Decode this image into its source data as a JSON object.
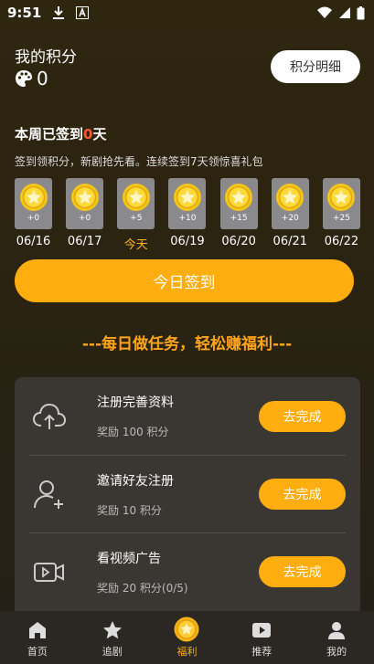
{
  "status_bar": {
    "time": "9:51"
  },
  "points": {
    "label": "我的积分",
    "value": "0",
    "detail_button": "积分明细"
  },
  "checkin": {
    "title_prefix": "本周已签到",
    "days_count": "0",
    "title_suffix": "天",
    "subtitle": "签到领积分，新剧抢先看。连续签到7天领惊喜礼包",
    "days": [
      {
        "reward": "+0",
        "date": "06/16",
        "today": false
      },
      {
        "reward": "+0",
        "date": "06/17",
        "today": false
      },
      {
        "reward": "+5",
        "date": "今天",
        "today": true
      },
      {
        "reward": "+10",
        "date": "06/19",
        "today": false
      },
      {
        "reward": "+15",
        "date": "06/20",
        "today": false
      },
      {
        "reward": "+20",
        "date": "06/21",
        "today": false
      },
      {
        "reward": "+25",
        "date": "06/22",
        "today": false
      }
    ],
    "button_label": "今日签到"
  },
  "slogan": "---每日做任务，轻松赚福利---",
  "tasks": [
    {
      "icon": "cloud-upload-icon",
      "title": "注册完善资料",
      "reward": "奖励 100 积分",
      "button": "去完成"
    },
    {
      "icon": "add-user-icon",
      "title": "邀请好友注册",
      "reward": "奖励 10 积分",
      "button": "去完成"
    },
    {
      "icon": "video-icon",
      "title": "看视频广告",
      "reward": "奖励 20 积分(0/5)",
      "button": "去完成"
    }
  ],
  "bottom_nav": [
    {
      "label": "首页",
      "icon": "home-icon",
      "active": false
    },
    {
      "label": "追剧",
      "icon": "star-icon",
      "active": false
    },
    {
      "label": "福利",
      "icon": "welfare-star-icon",
      "active": true
    },
    {
      "label": "推荐",
      "icon": "play-icon",
      "active": false
    },
    {
      "label": "我的",
      "icon": "user-icon",
      "active": false
    }
  ],
  "colors": {
    "accent": "#ffad0f",
    "highlight": "#ff5a2c",
    "panel": "#3a3632"
  }
}
